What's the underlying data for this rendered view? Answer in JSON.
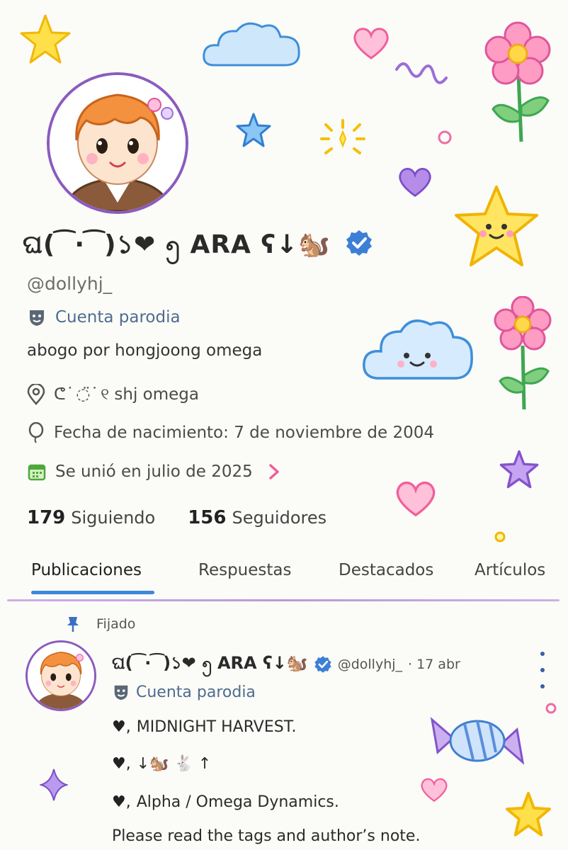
{
  "profile": {
    "display_name": "ଘ(  ͡ ·  ͡ )১❤ ၅ ARA ʕ↓🐿️",
    "handle": "@dollyhj_",
    "parody_label": "Cuenta parodia",
    "bio": "abogo por hongjoong omega",
    "location": "ᕦ ͘ ◌̈ ͘ ୧ shj omega",
    "birthdate": "Fecha de nacimiento: 7 de noviembre de 2004",
    "joined": "Se unió en julio de 2025",
    "following_count": "179",
    "following_label": "Siguiendo",
    "followers_count": "156",
    "followers_label": "Seguidores"
  },
  "tabs": [
    "Publicaciones",
    "Respuestas",
    "Destacados",
    "Artículos"
  ],
  "post": {
    "pinned_label": "Fijado",
    "author_name": "ଘ(  ͡ ·  ͡ )১❤ ၅ ARA ʕ↓🐿️",
    "author_handle": "@dollyhj_",
    "date": "· 17 abr",
    "parody_label": "Cuenta parodia",
    "line1": "MIDNIGHT HARVEST.",
    "line2_emojis": "↓🐿️  🐇 ↑",
    "line3": "Alpha / Omega Dynamics.",
    "line4": "Please read the tags and author’s note."
  },
  "colors": {
    "accent": "#3d87d9",
    "verified": "#3b7fd6",
    "avatar_ring": "#8a5bbf",
    "divider": "#b998dc"
  },
  "icons": [
    "verified-badge-icon",
    "theater-mask-icon",
    "location-pin-icon",
    "balloon-icon",
    "calendar-icon",
    "chevron-right-icon",
    "pin-icon",
    "more-vertical-icon"
  ]
}
